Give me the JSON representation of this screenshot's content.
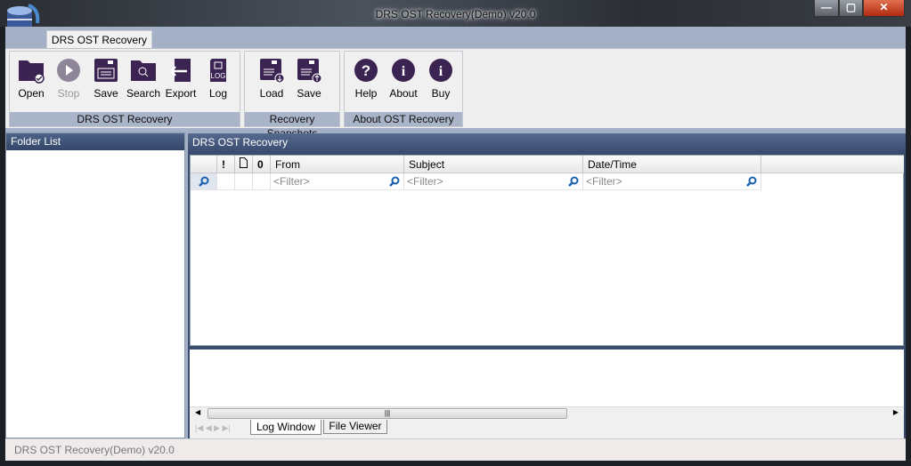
{
  "window": {
    "title": "DRS OST Recovery(Demo) v20.0",
    "minimize": "—",
    "maximize": "▢",
    "close": "✕"
  },
  "ribbon_tab": "DRS OST Recovery",
  "groups": [
    {
      "label": "DRS OST Recovery",
      "buttons": [
        {
          "label": "Open",
          "icon": "folder-open-icon"
        },
        {
          "label": "Stop",
          "icon": "stop-play-icon"
        },
        {
          "label": "Save",
          "icon": "floppy-save-icon"
        },
        {
          "label": "Search",
          "icon": "folder-search-icon"
        },
        {
          "label": "Export",
          "icon": "export-arrow-icon"
        },
        {
          "label": "Log",
          "icon": "log-file-icon"
        }
      ]
    },
    {
      "label": "Recovery Snapshots",
      "buttons": [
        {
          "label": "Load",
          "icon": "floppy-load-icon"
        },
        {
          "label": "Save",
          "icon": "floppy-upload-icon"
        }
      ]
    },
    {
      "label": "About OST Recovery",
      "buttons": [
        {
          "label": "Help",
          "icon": "help-icon"
        },
        {
          "label": "About",
          "icon": "info-icon"
        },
        {
          "label": "Buy",
          "icon": "info-icon"
        }
      ]
    }
  ],
  "folder_list": {
    "title": "Folder List"
  },
  "main": {
    "title": "DRS OST Recovery",
    "columns": [
      {
        "label": "!"
      },
      {
        "label": ""
      },
      {
        "label": ""
      },
      {
        "label": "From"
      },
      {
        "label": "Subject"
      },
      {
        "label": "Date/Time"
      }
    ],
    "filter_placeholder": "<Filter>"
  },
  "bottom_tabs": [
    "Log Window",
    "File Viewer"
  ],
  "status": "DRS OST Recovery(Demo) v20.0",
  "colors": {
    "icon": "#3b2452",
    "header": "#3f5275",
    "group_label": "#a9b4c8"
  }
}
